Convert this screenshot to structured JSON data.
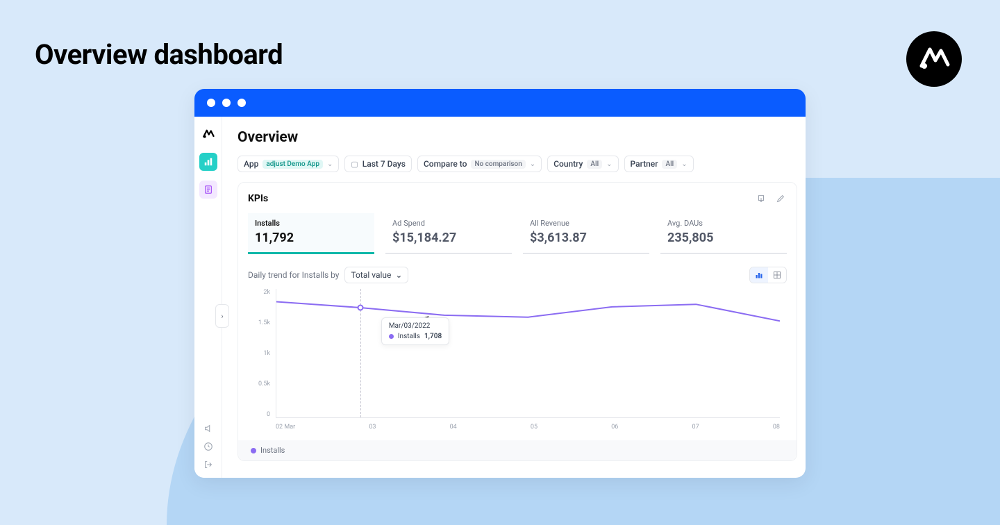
{
  "page_heading": "Overview dashboard",
  "app": {
    "title": "Overview",
    "filters": {
      "app_label": "App",
      "app_value": "adjust Demo App",
      "date_label": "Last 7 Days",
      "compare_label": "Compare to",
      "compare_value": "No comparison",
      "country_label": "Country",
      "country_value": "All",
      "partner_label": "Partner",
      "partner_value": "All"
    },
    "kpi_section_title": "KPIs",
    "kpis": [
      {
        "label": "Installs",
        "value": "11,792",
        "active": true
      },
      {
        "label": "Ad Spend",
        "value": "$15,184.27",
        "active": false
      },
      {
        "label": "All Revenue",
        "value": "$3,613.87",
        "active": false
      },
      {
        "label": "Avg. DAUs",
        "value": "235,805",
        "active": false
      }
    ],
    "trend_label": "Daily trend for Installs by",
    "trend_select": "Total value",
    "legend_series": "Installs",
    "tooltip": {
      "date": "Mar/03/2022",
      "series": "Installs",
      "value": "1,708"
    }
  },
  "chart_data": {
    "type": "line",
    "title": "Daily trend for Installs",
    "xlabel": "",
    "ylabel": "",
    "ylim": [
      0,
      2000
    ],
    "y_ticks": [
      "2k",
      "1.5k",
      "1k",
      "0.5k",
      "0"
    ],
    "categories": [
      "02 Mar",
      "03",
      "04",
      "05",
      "06",
      "07",
      "08"
    ],
    "series": [
      {
        "name": "Installs",
        "values": [
          1800,
          1708,
          1590,
          1560,
          1720,
          1760,
          1500
        ],
        "color": "#8b6cf2"
      }
    ],
    "hover_index": 1
  }
}
